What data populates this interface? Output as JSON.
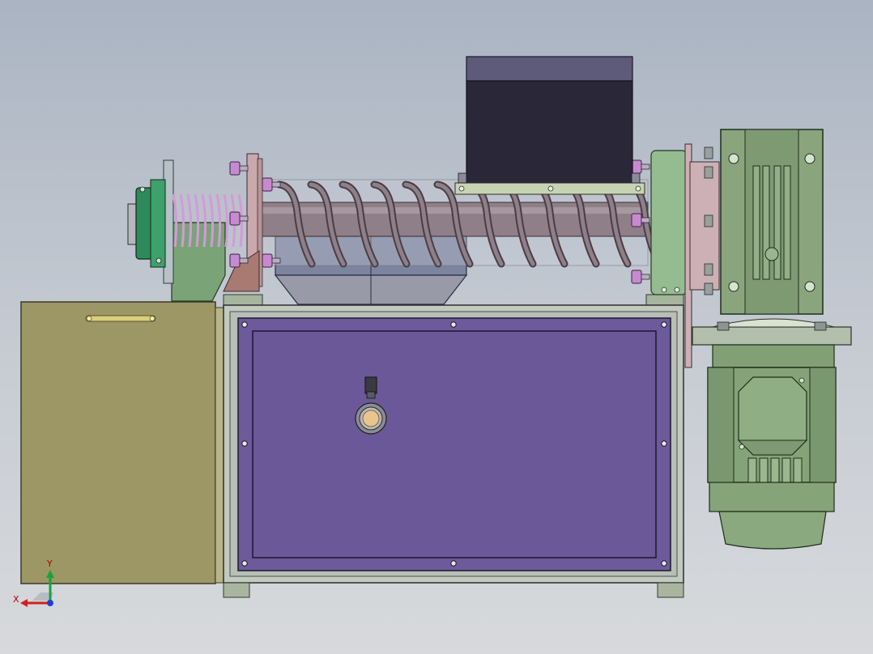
{
  "view": {
    "background": [
      "#aab4c2",
      "#d7d9dc"
    ]
  },
  "triad": {
    "x_label": "X",
    "y_label": "Y",
    "x_color": "#d21f1f",
    "y_color": "#18a33a",
    "z_color": "#1d3fd6"
  },
  "colors": {
    "hopper_top": "#5e5a7a",
    "hopper_body": "#2a2838",
    "screw": "#8f7f88",
    "spring": "#d49ad8",
    "bolt_head": "#c68ad0",
    "panel_purple": "#6c5a9a",
    "frame_gray": "#c3c9c1",
    "side_box": "#9d9766",
    "motor_green": "#8aa57e",
    "bearing_green": "#2f8a5a",
    "flange_green": "#94bc90",
    "flange_pink": "#cdb0b5",
    "collector_tank": "#7d84a0"
  }
}
